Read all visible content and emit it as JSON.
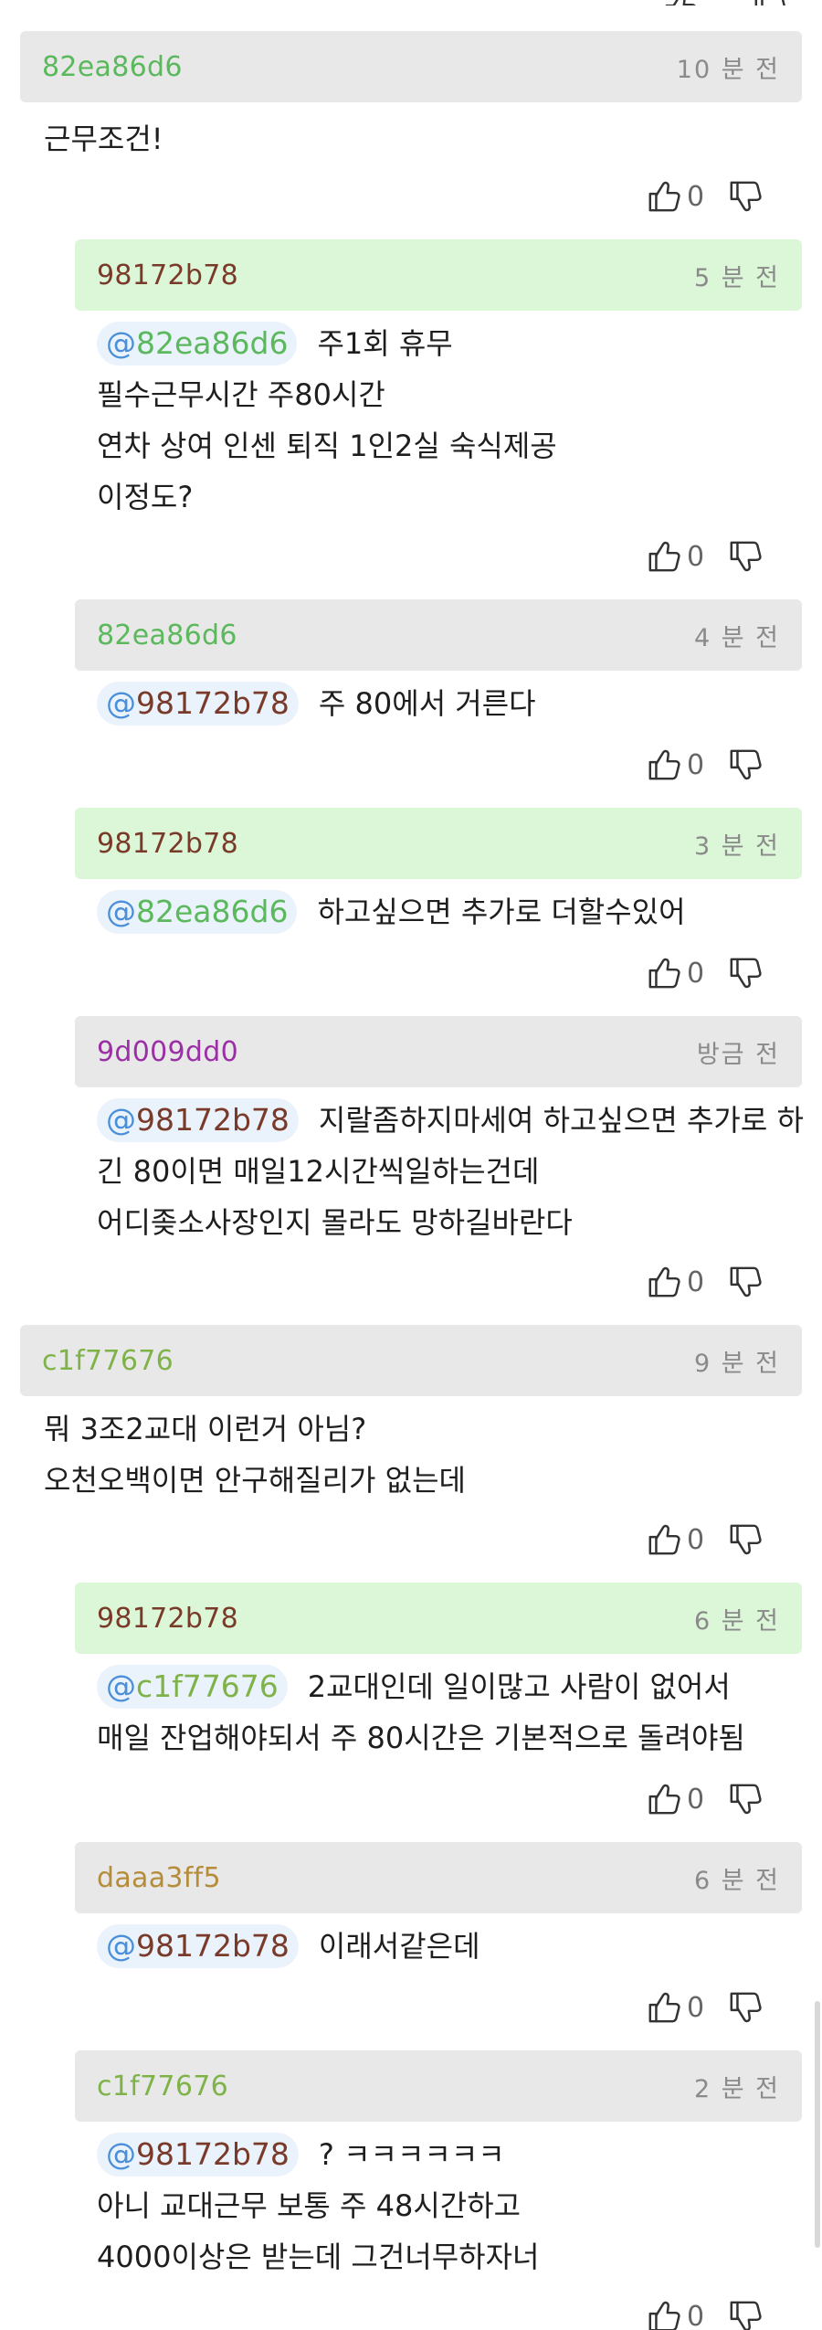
{
  "colors": {
    "82ea86d6": "#5cb85c",
    "98172b78": "#7a3a2a",
    "9d009dd0": "#9b2fa6",
    "c1f77676": "#7fb34a",
    "daaa3ff5": "#b58d3a",
    "mention_at": "#4a8fd8"
  },
  "comments": [
    {
      "author": "82ea86d6",
      "time": "10 분 전",
      "header": "gray",
      "mention": null,
      "lines": [
        "근무조건!"
      ],
      "likes": "0"
    },
    {
      "author": "98172b78",
      "time": "5 분 전",
      "header": "green",
      "mention": "82ea86d6",
      "lines": [
        "주1회 휴무",
        "필수근무시간 주80시간",
        "연차 상여 인센 퇴직 1인2실 숙식제공",
        "이정도?"
      ],
      "likes": "0"
    },
    {
      "author": "82ea86d6",
      "time": "4 분 전",
      "header": "gray",
      "mention": "98172b78",
      "lines": [
        "주 80에서 거른다"
      ],
      "likes": "0"
    },
    {
      "author": "98172b78",
      "time": "3 분 전",
      "header": "green",
      "mention": "82ea86d6",
      "lines": [
        "하고싶으면 추가로 더할수있어"
      ],
      "likes": "0"
    },
    {
      "author": "9d009dd0",
      "time": "방금 전",
      "header": "gray",
      "mention": "98172b78",
      "lines": [
        "지랄좀하지마세여 하고싶으면 추가로 하",
        "긴 80이면 매일12시간씩일하는건데",
        "어디좆소사장인지 몰라도 망하길바란다"
      ],
      "likes": "0"
    },
    {
      "author": "c1f77676",
      "time": "9 분 전",
      "header": "gray",
      "mention": null,
      "lines": [
        "뭐 3조2교대 이런거 아님?",
        "오천오백이면 안구해질리가 없는데"
      ],
      "likes": "0"
    },
    {
      "author": "98172b78",
      "time": "6 분 전",
      "header": "green",
      "mention": "c1f77676",
      "lines": [
        "2교대인데 일이많고 사람이 없어서",
        "매일 잔업해야되서 주 80시간은 기본적으로 돌려야됨"
      ],
      "likes": "0"
    },
    {
      "author": "daaa3ff5",
      "time": "6 분 전",
      "header": "gray",
      "mention": "98172b78",
      "lines": [
        "이래서같은데"
      ],
      "likes": "0"
    },
    {
      "author": "c1f77676",
      "time": "2 분 전",
      "header": "gray",
      "mention": "98172b78",
      "lines": [
        "? ㅋㅋㅋㅋㅋㅋ",
        "아니 교대근무 보통 주 48시간하고",
        "4000이상은 받는데 그건너무하자너"
      ],
      "likes": "0"
    }
  ]
}
